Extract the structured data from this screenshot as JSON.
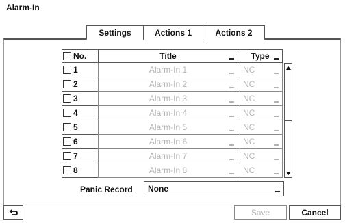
{
  "window": {
    "title": "Alarm-In"
  },
  "tabs": [
    {
      "label": "Settings",
      "active": true
    },
    {
      "label": "Actions 1",
      "active": false
    },
    {
      "label": "Actions 2",
      "active": false
    }
  ],
  "table": {
    "headers": {
      "no": "No.",
      "title": "Title",
      "type": "Type"
    },
    "rows": [
      {
        "no": "1",
        "title": "Alarm-In 1",
        "type": "NC"
      },
      {
        "no": "2",
        "title": "Alarm-In 2",
        "type": "NC"
      },
      {
        "no": "3",
        "title": "Alarm-In 3",
        "type": "NC"
      },
      {
        "no": "4",
        "title": "Alarm-In 4",
        "type": "NC"
      },
      {
        "no": "5",
        "title": "Alarm-In 5",
        "type": "NC"
      },
      {
        "no": "6",
        "title": "Alarm-In 6",
        "type": "NC"
      },
      {
        "no": "7",
        "title": "Alarm-In 7",
        "type": "NC"
      },
      {
        "no": "8",
        "title": "Alarm-In 8",
        "type": "NC"
      }
    ]
  },
  "panic_record": {
    "label": "Panic Record",
    "value": "None"
  },
  "footer": {
    "save_label": "Save",
    "cancel_label": "Cancel"
  },
  "icons": {
    "back": "back-arrow-icon",
    "scroll_up": "arrow-up-icon",
    "scroll_down": "arrow-down-icon"
  },
  "colors": {
    "disabled_text": "#b4b4b4",
    "border": "#555555"
  }
}
